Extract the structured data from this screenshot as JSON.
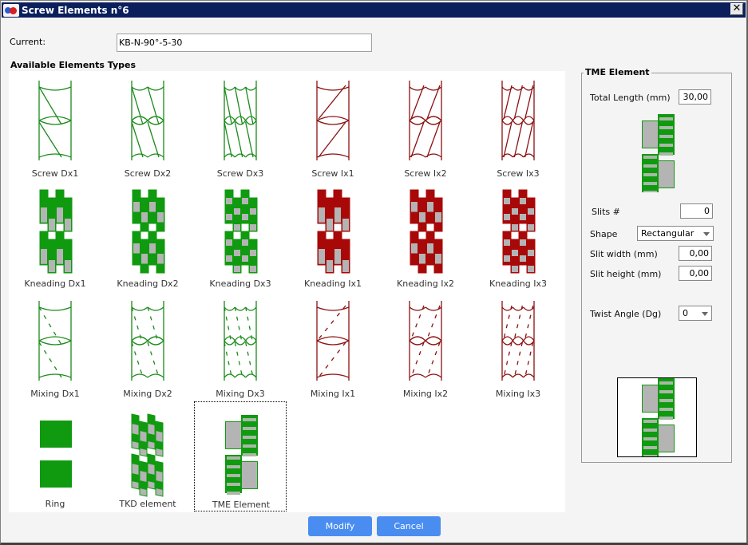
{
  "window": {
    "title": "Screw Elements n°6",
    "close_label": "✕"
  },
  "current": {
    "label": "Current:",
    "value": "KB-N-90°-5-30"
  },
  "available": {
    "heading": "Available Elements Types",
    "selected": "TME Element",
    "elements": [
      {
        "label": "Screw Dx1",
        "kind": "screw",
        "dir": "dx",
        "n": 1,
        "color": "#1a8a1a"
      },
      {
        "label": "Screw Dx2",
        "kind": "screw",
        "dir": "dx",
        "n": 2,
        "color": "#1a8a1a"
      },
      {
        "label": "Screw Dx3",
        "kind": "screw",
        "dir": "dx",
        "n": 3,
        "color": "#1a8a1a"
      },
      {
        "label": "Screw Ix1",
        "kind": "screw",
        "dir": "ix",
        "n": 1,
        "color": "#8b1010"
      },
      {
        "label": "Screw Ix2",
        "kind": "screw",
        "dir": "ix",
        "n": 2,
        "color": "#8b1010"
      },
      {
        "label": "Screw Ix3",
        "kind": "screw",
        "dir": "ix",
        "n": 3,
        "color": "#8b1010"
      },
      {
        "label": "Kneading Dx1",
        "kind": "kneading",
        "dir": "dx",
        "n": 1,
        "color": "#0f9a0f"
      },
      {
        "label": "Kneading Dx2",
        "kind": "kneading",
        "dir": "dx",
        "n": 2,
        "color": "#0f9a0f"
      },
      {
        "label": "Kneading Dx3",
        "kind": "kneading",
        "dir": "dx",
        "n": 3,
        "color": "#0f9a0f"
      },
      {
        "label": "Kneading Ix1",
        "kind": "kneading",
        "dir": "ix",
        "n": 1,
        "color": "#a80808"
      },
      {
        "label": "Kneading Ix2",
        "kind": "kneading",
        "dir": "ix",
        "n": 2,
        "color": "#a80808"
      },
      {
        "label": "Kneading Ix3",
        "kind": "kneading",
        "dir": "ix",
        "n": 3,
        "color": "#a80808"
      },
      {
        "label": "Mixing Dx1",
        "kind": "mixing",
        "dir": "dx",
        "n": 1,
        "color": "#1a8a1a"
      },
      {
        "label": "Mixing Dx2",
        "kind": "mixing",
        "dir": "dx",
        "n": 2,
        "color": "#1a8a1a"
      },
      {
        "label": "Mixing Dx3",
        "kind": "mixing",
        "dir": "dx",
        "n": 3,
        "color": "#1a8a1a"
      },
      {
        "label": "Mixing Ix1",
        "kind": "mixing",
        "dir": "ix",
        "n": 1,
        "color": "#8b1010"
      },
      {
        "label": "Mixing Ix2",
        "kind": "mixing",
        "dir": "ix",
        "n": 2,
        "color": "#8b1010"
      },
      {
        "label": "Mixing Ix3",
        "kind": "mixing",
        "dir": "ix",
        "n": 3,
        "color": "#8b1010"
      },
      {
        "label": "Ring",
        "kind": "ring",
        "dir": "",
        "n": 0,
        "color": "#0f9a0f"
      },
      {
        "label": "TKD element",
        "kind": "tkd",
        "dir": "",
        "n": 0,
        "color": "#0f9a0f"
      },
      {
        "label": "TME Element",
        "kind": "tme",
        "dir": "",
        "n": 0,
        "color": "#0f9a0f"
      }
    ]
  },
  "tme_panel": {
    "title": "TME Element",
    "total_length_label": "Total Length (mm)",
    "total_length_value": "30,00",
    "slits_label": "Slits #",
    "slits_value": "0",
    "shape_label": "Shape",
    "shape_value": "Rectangular",
    "slit_width_label": "Slit width (mm)",
    "slit_width_value": "0,00",
    "slit_height_label": "Slit height (mm)",
    "slit_height_value": "0,00",
    "twist_angle_label": "Twist Angle (Dg)",
    "twist_angle_value": "0"
  },
  "buttons": {
    "modify": "Modify",
    "cancel": "Cancel"
  },
  "colors": {
    "title_bar": "#0a1f5c",
    "button": "#4a8df0",
    "green": "#0f9a0f",
    "red": "#a80808",
    "gray": "#b4b4b4"
  }
}
